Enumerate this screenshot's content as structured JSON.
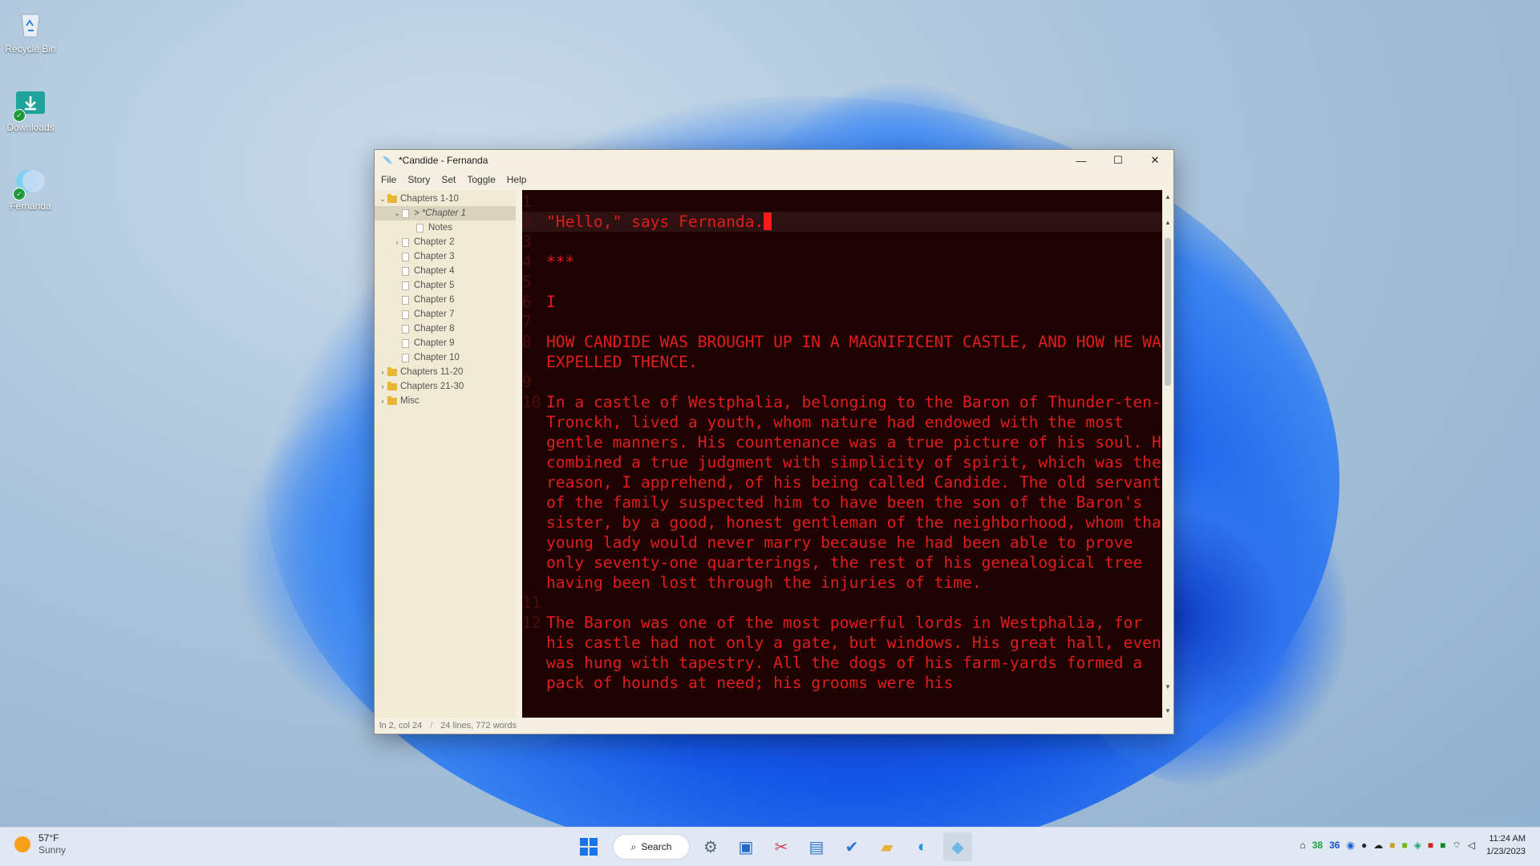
{
  "desktop": {
    "icons": [
      {
        "label": "Recycle Bin"
      },
      {
        "label": "Downloads"
      },
      {
        "label": "Fernanda"
      }
    ]
  },
  "window": {
    "title": "*Candide - Fernanda",
    "menu": [
      "File",
      "Story",
      "Set",
      "Toggle",
      "Help"
    ],
    "tree": [
      {
        "label": "Chapters 1-10"
      },
      {
        "label": "> *Chapter 1"
      },
      {
        "label": "Notes"
      },
      {
        "label": "Chapter 2"
      },
      {
        "label": "Chapter 3"
      },
      {
        "label": "Chapter 4"
      },
      {
        "label": "Chapter 5"
      },
      {
        "label": "Chapter 6"
      },
      {
        "label": "Chapter 7"
      },
      {
        "label": "Chapter 8"
      },
      {
        "label": "Chapter 9"
      },
      {
        "label": "Chapter 10"
      },
      {
        "label": "Chapters 11-20"
      },
      {
        "label": "Chapters 21-30"
      },
      {
        "label": "Misc"
      }
    ],
    "editor": {
      "lines": [
        {
          "n": "1",
          "text": ""
        },
        {
          "n": "2",
          "text": "\"Hello,\" says Fernanda."
        },
        {
          "n": "3",
          "text": ""
        },
        {
          "n": "4",
          "text": "***"
        },
        {
          "n": "5",
          "text": ""
        },
        {
          "n": "6",
          "text": "I"
        },
        {
          "n": "7",
          "text": ""
        },
        {
          "n": "8",
          "text": "HOW CANDIDE WAS BROUGHT UP IN A MAGNIFICENT CASTLE, AND HOW HE WAS EXPELLED THENCE."
        },
        {
          "n": "9",
          "text": ""
        },
        {
          "n": "10",
          "text": "In a castle of Westphalia, belonging to the Baron of Thunder-ten-Tronckh, lived a youth, whom nature had endowed with the most gentle manners. His countenance was a true picture of his soul. He combined a true judgment with simplicity of spirit, which was the reason, I apprehend, of his being called Candide. The old servants of the family suspected him to have been the son of the Baron's sister, by a good, honest gentleman of the neighborhood, whom that young lady would never marry because he had been able to prove only seventy-one quarterings, the rest of his genealogical tree having been lost through the injuries of time."
        },
        {
          "n": "11",
          "text": ""
        },
        {
          "n": "12",
          "text": "The Baron was one of the most powerful lords in Westphalia, for his castle had not only a gate, but windows. His great hall, even, was hung with tapestry. All the dogs of his farm-yards formed a pack of hounds at need; his grooms were his"
        }
      ]
    },
    "status": {
      "position": "ln 2, col 24",
      "counts": "24 lines, 772 words"
    }
  },
  "taskbar": {
    "weather_temp": "57°F",
    "weather_desc": "Sunny",
    "search_label": "Search",
    "tray_num1": "38",
    "tray_num2": "36",
    "time": "11:24 AM",
    "date": "1/23/2023"
  }
}
